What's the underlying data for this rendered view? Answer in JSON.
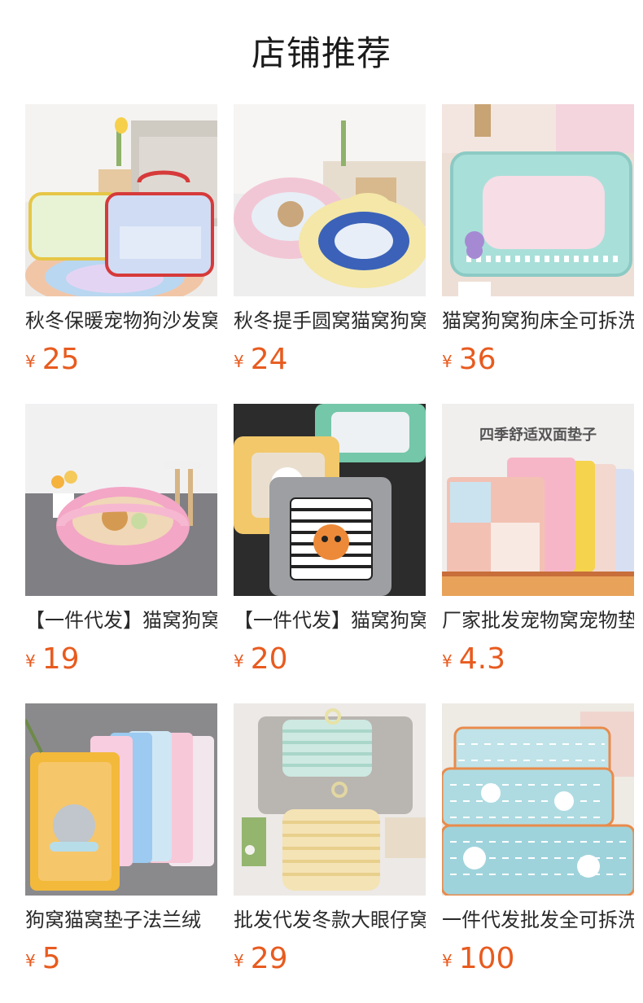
{
  "section": {
    "title": "店铺推荐"
  },
  "currency_symbol": "¥",
  "products": [
    {
      "name": "秋冬保暖宠物狗沙发窝",
      "price": "25",
      "image_icon": "plaid-sofa-pet-beds-photo"
    },
    {
      "name": "秋冬提手圆窝猫窝狗窝",
      "price": "24",
      "image_icon": "round-handle-pet-beds-photo"
    },
    {
      "name": "猫窝狗窝狗床全可拆洗",
      "price": "36",
      "image_icon": "mint-square-pet-bed-photo"
    },
    {
      "name": "【一件代发】猫窝狗窝",
      "price": "19",
      "image_icon": "pink-round-pet-bed-photo"
    },
    {
      "name": "【一件代发】猫窝狗窝",
      "price": "20",
      "image_icon": "square-cartoon-pet-beds-photo"
    },
    {
      "name": "厂家批发宠物窝宠物垫",
      "price": "4.3",
      "image_icon": "reversible-pet-mats-photo"
    },
    {
      "name": "狗窝猫窝垫子法兰绒",
      "price": "5",
      "image_icon": "flannel-pet-mats-photo"
    },
    {
      "name": "批发代发冬款大眼仔窝",
      "price": "29",
      "image_icon": "striped-pet-beds-photo"
    },
    {
      "name": "一件代发批发全可拆洗",
      "price": "100",
      "image_icon": "check-pattern-pet-beds-photo"
    }
  ],
  "image_texts": {
    "mats_banner": "四季舒适双面垫子"
  },
  "colors": {
    "price": "#e85b1f",
    "title": "#1b1b1b",
    "name": "#2a2a2a"
  }
}
